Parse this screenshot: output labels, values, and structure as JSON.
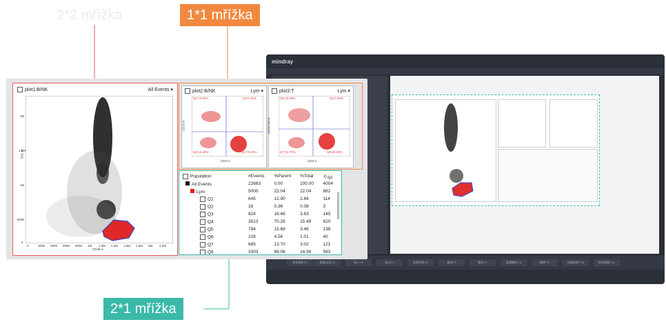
{
  "callouts": {
    "grid22": "2*2 mřížka",
    "grid11": "1*1 mřížka",
    "grid21": "2*1 mřížka"
  },
  "colors": {
    "red_frame": "#e85a5a",
    "orange_frame": "#f0893f",
    "teal_frame": "#3bb9a9"
  },
  "plot1": {
    "title": "plot1:B/NK",
    "gate": "All Events",
    "x_label": "CD45-A",
    "y_label": "SSC-H",
    "x_ticks": [
      "0",
      "200K",
      "400K",
      "600K",
      "800K",
      "1M",
      "1.2M",
      "1.4M",
      "1.6M",
      "1.8M",
      "2M",
      "2.2M"
    ],
    "y_ticks": [
      "2M",
      "1.5M",
      "1M",
      "500K",
      "0"
    ]
  },
  "plot2": {
    "title": "plot2:B/NK",
    "gate": "Lym",
    "x_label": "CD3-A",
    "y_label": "CD19-A",
    "quadrants": [
      "Q1:12.90%",
      "Q2:0.36%",
      "Q3:16.48%",
      "Q4:70.26%"
    ]
  },
  "plot3": {
    "title": "plot3:T",
    "gate": "Lym",
    "x_label": "CD3-A",
    "y_label": "CD16+56-A",
    "quadrants": [
      "Q5:15.68%",
      "Q6:4.56%",
      "Q7:13.70%",
      "Q8:66.06%"
    ]
  },
  "table": {
    "headers": [
      "Population",
      "#Events",
      "%Parent",
      "%Total",
      "个/μl"
    ],
    "rows": [
      {
        "name": "All Events",
        "events": "22683",
        "parent": "0.00",
        "total": "100.00",
        "perul": "4004"
      },
      {
        "name": "Lym",
        "events": "5000",
        "parent": "22.04",
        "total": "22.04",
        "perul": "882"
      },
      {
        "name": "Q1",
        "events": "645",
        "parent": "12.90",
        "total": "2.84",
        "perul": "114"
      },
      {
        "name": "Q2",
        "events": "18",
        "parent": "0.36",
        "total": "0.08",
        "perul": "3"
      },
      {
        "name": "Q3",
        "events": "824",
        "parent": "16.48",
        "total": "3.63",
        "perul": "145"
      },
      {
        "name": "Q4",
        "events": "3513",
        "parent": "70.26",
        "total": "15.49",
        "perul": "620"
      },
      {
        "name": "Q5",
        "events": "784",
        "parent": "15.68",
        "total": "3.46",
        "perul": "138"
      },
      {
        "name": "Q6",
        "events": "228",
        "parent": "4.56",
        "total": "1.01",
        "perul": "40"
      },
      {
        "name": "Q7",
        "events": "685",
        "parent": "13.70",
        "total": "3.02",
        "perul": "121"
      },
      {
        "name": "Q8",
        "events": "3303",
        "parent": "66.06",
        "total": "14.56",
        "perul": "583"
      }
    ]
  },
  "window": {
    "brand": "mindray",
    "buttons": [
      "样本审核 F1",
      "数据浏览 F2",
      "导入 F3",
      "导出 F4",
      "在线作图 F5",
      "查询 F6",
      "解析 F7",
      "批量解析 F8",
      "删除 F9",
      "创建结果 F10",
      "取消查看 F11"
    ]
  }
}
